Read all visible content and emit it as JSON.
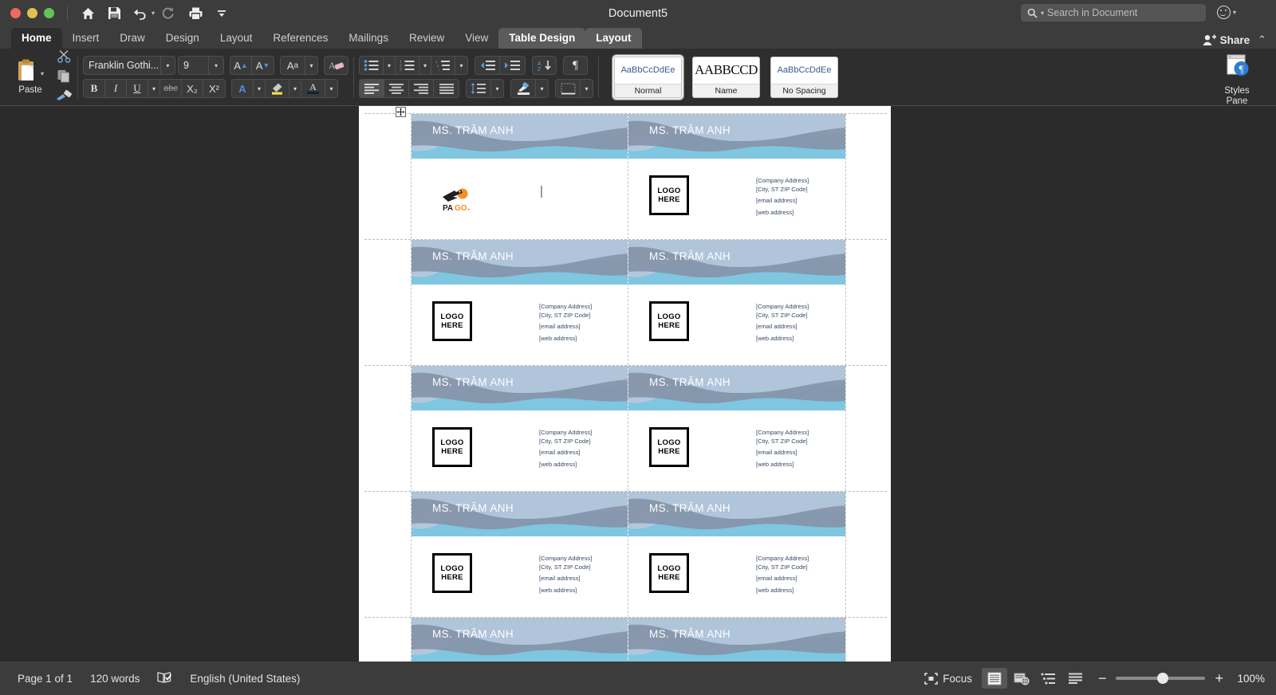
{
  "window": {
    "title": "Document5",
    "traffic_lights": [
      "close-red",
      "minimize-yellow",
      "maximize-green"
    ],
    "quick_access": [
      {
        "name": "home-icon",
        "label": "Home"
      },
      {
        "name": "save-icon",
        "label": "Save"
      },
      {
        "name": "undo-icon",
        "label": "Undo"
      },
      {
        "name": "redo-icon",
        "label": "Redo"
      },
      {
        "name": "print-icon",
        "label": "Print"
      },
      {
        "name": "customize-toolbar-icon",
        "label": "Customize"
      }
    ]
  },
  "search": {
    "placeholder": "Search in Document",
    "icon": "search-icon"
  },
  "share": {
    "label": "Share",
    "icon": "person-plus-icon",
    "collapse_icon": "chevron-up-icon",
    "smiley_icon": "smiley-feedback-icon"
  },
  "tabs": [
    {
      "label": "Home",
      "state": "active"
    },
    {
      "label": "Insert",
      "state": "normal"
    },
    {
      "label": "Draw",
      "state": "normal"
    },
    {
      "label": "Design",
      "state": "normal"
    },
    {
      "label": "Layout",
      "state": "normal"
    },
    {
      "label": "References",
      "state": "normal"
    },
    {
      "label": "Mailings",
      "state": "normal"
    },
    {
      "label": "Review",
      "state": "normal"
    },
    {
      "label": "View",
      "state": "normal"
    },
    {
      "label": "Table Design",
      "state": "contextual"
    },
    {
      "label": "Layout",
      "state": "contextual"
    }
  ],
  "ribbon": {
    "clipboard": {
      "paste_label": "Paste",
      "paste_icon": "clipboard-paste-icon",
      "cut_icon": "scissors-icon",
      "copy_icon": "copy-icon",
      "format_painter_icon": "paintbrush-icon"
    },
    "font": {
      "font_name": "Franklin Gothi...",
      "font_size": "9",
      "grow_font_icon": "grow-font-icon",
      "shrink_font_icon": "shrink-font-icon",
      "change_case_icon": "change-case-icon",
      "clear_formatting_icon": "clear-formatting-icon",
      "bold_label": "B",
      "italic_label": "I",
      "underline_label": "U",
      "strikethrough_label": "abc",
      "subscript_label": "X₂",
      "superscript_label": "X²",
      "text_effects_label": "A",
      "highlight_icon": "highlight-icon",
      "font_color_label": "A",
      "highlight_color": "#f5e03c",
      "font_color": "#12233f"
    },
    "paragraph": {
      "bullets_icon": "bullet-list-icon",
      "numbering_icon": "numbered-list-icon",
      "multilevel_icon": "multilevel-list-icon",
      "decrease_indent_icon": "decrease-indent-icon",
      "increase_indent_icon": "increase-indent-icon",
      "sort_icon": "sort-az-icon",
      "show_marks_icon": "pilcrow-icon",
      "align_left_icon": "align-left-icon",
      "align_center_icon": "align-center-icon",
      "align_right_icon": "align-right-icon",
      "justify_icon": "justify-icon",
      "line_spacing_icon": "line-spacing-icon",
      "shading_icon": "shading-icon",
      "borders_icon": "borders-icon"
    },
    "styles": [
      {
        "preview": "AaBbCcDdEe",
        "name": "Normal",
        "selected": true
      },
      {
        "preview": "AABBCCD",
        "name": "Name",
        "selected": false
      },
      {
        "preview": "AaBbCcDdEe",
        "name": "No Spacing",
        "selected": false
      }
    ],
    "styles_pane": {
      "label_line1": "Styles",
      "label_line2": "Pane",
      "icon": "styles-pane-icon"
    }
  },
  "document": {
    "table_move_handle_icon": "table-move-handle-icon",
    "card_template": {
      "name": "MS. TRÂM ANH",
      "logo_line1": "LOGO",
      "logo_line2": "HERE",
      "address_lines": [
        "[Company Address]",
        "[City, ST  ZIP Code]",
        "[email address]",
        "[web address]"
      ],
      "wave_color_light": "#b3c6dc",
      "wave_color_slate": "#8594a9",
      "wave_color_cyan": "#79c3de",
      "name_color": "#ffffff",
      "address_color": "#3a4a66"
    },
    "pago_logo": {
      "text_part1": "PA",
      "text_part2": "GO",
      "color_part1": "#231f20",
      "color_part2": "#f6921e"
    },
    "rows": [
      {
        "cells": [
          {
            "kind": "pago",
            "name": "MS. TRÂM ANH",
            "has_caret": true
          },
          {
            "kind": "logo",
            "name": "MS. TRÂM ANH",
            "has_caret": false
          }
        ]
      },
      {
        "cells": [
          {
            "kind": "logo",
            "name": "MS. TRÂM ANH",
            "has_caret": false
          },
          {
            "kind": "logo",
            "name": "MS. TRÂM ANH",
            "has_caret": false
          }
        ]
      },
      {
        "cells": [
          {
            "kind": "logo",
            "name": "MS. TRÂM ANH",
            "has_caret": false
          },
          {
            "kind": "logo",
            "name": "MS. TRÂM ANH",
            "has_caret": false
          }
        ]
      },
      {
        "cells": [
          {
            "kind": "logo",
            "name": "MS. TRÂM ANH",
            "has_caret": false
          },
          {
            "kind": "logo",
            "name": "MS. TRÂM ANH",
            "has_caret": false
          }
        ]
      },
      {
        "cells": [
          {
            "kind": "partial",
            "name": "MS. TRÂM ANH",
            "has_caret": false
          },
          {
            "kind": "partial",
            "name": "MS. TRÂM ANH",
            "has_caret": false
          }
        ]
      }
    ]
  },
  "status": {
    "page": "Page 1 of 1",
    "words": "120 words",
    "proofing_icon": "proofing-check-icon",
    "language": "English (United States)",
    "focus_label": "Focus",
    "focus_icon": "focus-mode-icon",
    "views": [
      {
        "name": "print-layout-view",
        "selected": true
      },
      {
        "name": "web-layout-view",
        "selected": false
      },
      {
        "name": "outline-view",
        "selected": false
      },
      {
        "name": "draft-view",
        "selected": false
      }
    ],
    "zoom_out_icon": "zoom-out-icon",
    "zoom_in_icon": "zoom-in-icon",
    "zoom_level": "100%"
  }
}
